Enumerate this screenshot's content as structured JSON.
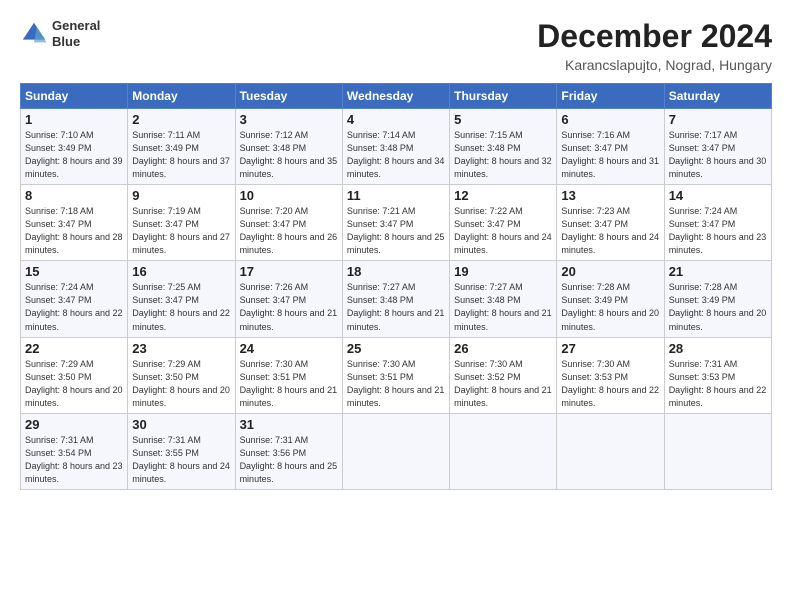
{
  "header": {
    "logo_line1": "General",
    "logo_line2": "Blue",
    "month": "December 2024",
    "location": "Karancslapujto, Nograd, Hungary"
  },
  "days_of_week": [
    "Sunday",
    "Monday",
    "Tuesday",
    "Wednesday",
    "Thursday",
    "Friday",
    "Saturday"
  ],
  "weeks": [
    [
      {
        "num": "1",
        "sunrise": "7:10 AM",
        "sunset": "3:49 PM",
        "daylight": "8 hours and 39 minutes."
      },
      {
        "num": "2",
        "sunrise": "7:11 AM",
        "sunset": "3:49 PM",
        "daylight": "8 hours and 37 minutes."
      },
      {
        "num": "3",
        "sunrise": "7:12 AM",
        "sunset": "3:48 PM",
        "daylight": "8 hours and 35 minutes."
      },
      {
        "num": "4",
        "sunrise": "7:14 AM",
        "sunset": "3:48 PM",
        "daylight": "8 hours and 34 minutes."
      },
      {
        "num": "5",
        "sunrise": "7:15 AM",
        "sunset": "3:48 PM",
        "daylight": "8 hours and 32 minutes."
      },
      {
        "num": "6",
        "sunrise": "7:16 AM",
        "sunset": "3:47 PM",
        "daylight": "8 hours and 31 minutes."
      },
      {
        "num": "7",
        "sunrise": "7:17 AM",
        "sunset": "3:47 PM",
        "daylight": "8 hours and 30 minutes."
      }
    ],
    [
      {
        "num": "8",
        "sunrise": "7:18 AM",
        "sunset": "3:47 PM",
        "daylight": "8 hours and 28 minutes."
      },
      {
        "num": "9",
        "sunrise": "7:19 AM",
        "sunset": "3:47 PM",
        "daylight": "8 hours and 27 minutes."
      },
      {
        "num": "10",
        "sunrise": "7:20 AM",
        "sunset": "3:47 PM",
        "daylight": "8 hours and 26 minutes."
      },
      {
        "num": "11",
        "sunrise": "7:21 AM",
        "sunset": "3:47 PM",
        "daylight": "8 hours and 25 minutes."
      },
      {
        "num": "12",
        "sunrise": "7:22 AM",
        "sunset": "3:47 PM",
        "daylight": "8 hours and 24 minutes."
      },
      {
        "num": "13",
        "sunrise": "7:23 AM",
        "sunset": "3:47 PM",
        "daylight": "8 hours and 24 minutes."
      },
      {
        "num": "14",
        "sunrise": "7:24 AM",
        "sunset": "3:47 PM",
        "daylight": "8 hours and 23 minutes."
      }
    ],
    [
      {
        "num": "15",
        "sunrise": "7:24 AM",
        "sunset": "3:47 PM",
        "daylight": "8 hours and 22 minutes."
      },
      {
        "num": "16",
        "sunrise": "7:25 AM",
        "sunset": "3:47 PM",
        "daylight": "8 hours and 22 minutes."
      },
      {
        "num": "17",
        "sunrise": "7:26 AM",
        "sunset": "3:47 PM",
        "daylight": "8 hours and 21 minutes."
      },
      {
        "num": "18",
        "sunrise": "7:27 AM",
        "sunset": "3:48 PM",
        "daylight": "8 hours and 21 minutes."
      },
      {
        "num": "19",
        "sunrise": "7:27 AM",
        "sunset": "3:48 PM",
        "daylight": "8 hours and 21 minutes."
      },
      {
        "num": "20",
        "sunrise": "7:28 AM",
        "sunset": "3:49 PM",
        "daylight": "8 hours and 20 minutes."
      },
      {
        "num": "21",
        "sunrise": "7:28 AM",
        "sunset": "3:49 PM",
        "daylight": "8 hours and 20 minutes."
      }
    ],
    [
      {
        "num": "22",
        "sunrise": "7:29 AM",
        "sunset": "3:50 PM",
        "daylight": "8 hours and 20 minutes."
      },
      {
        "num": "23",
        "sunrise": "7:29 AM",
        "sunset": "3:50 PM",
        "daylight": "8 hours and 20 minutes."
      },
      {
        "num": "24",
        "sunrise": "7:30 AM",
        "sunset": "3:51 PM",
        "daylight": "8 hours and 21 minutes."
      },
      {
        "num": "25",
        "sunrise": "7:30 AM",
        "sunset": "3:51 PM",
        "daylight": "8 hours and 21 minutes."
      },
      {
        "num": "26",
        "sunrise": "7:30 AM",
        "sunset": "3:52 PM",
        "daylight": "8 hours and 21 minutes."
      },
      {
        "num": "27",
        "sunrise": "7:30 AM",
        "sunset": "3:53 PM",
        "daylight": "8 hours and 22 minutes."
      },
      {
        "num": "28",
        "sunrise": "7:31 AM",
        "sunset": "3:53 PM",
        "daylight": "8 hours and 22 minutes."
      }
    ],
    [
      {
        "num": "29",
        "sunrise": "7:31 AM",
        "sunset": "3:54 PM",
        "daylight": "8 hours and 23 minutes."
      },
      {
        "num": "30",
        "sunrise": "7:31 AM",
        "sunset": "3:55 PM",
        "daylight": "8 hours and 24 minutes."
      },
      {
        "num": "31",
        "sunrise": "7:31 AM",
        "sunset": "3:56 PM",
        "daylight": "8 hours and 25 minutes."
      },
      null,
      null,
      null,
      null
    ]
  ]
}
